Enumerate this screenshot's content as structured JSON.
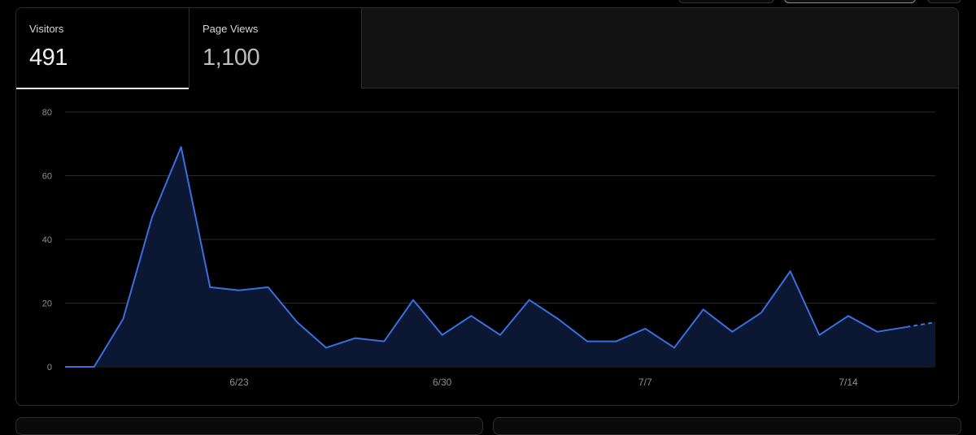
{
  "tabs": [
    {
      "label": "Visitors",
      "value": "491"
    },
    {
      "label": "Page Views",
      "value": "1,100"
    }
  ],
  "chart_data": {
    "type": "area",
    "title": "",
    "xlabel": "",
    "ylabel": "",
    "ylim": [
      0,
      80
    ],
    "yticks": [
      0,
      20,
      40,
      60,
      80
    ],
    "x": [
      "6/17",
      "6/18",
      "6/19",
      "6/20",
      "6/21",
      "6/22",
      "6/23",
      "6/24",
      "6/25",
      "6/26",
      "6/27",
      "6/28",
      "6/29",
      "6/30",
      "7/1",
      "7/2",
      "7/3",
      "7/4",
      "7/5",
      "7/6",
      "7/7",
      "7/8",
      "7/9",
      "7/10",
      "7/11",
      "7/12",
      "7/13",
      "7/14",
      "7/15",
      "7/16",
      "7/17"
    ],
    "xtick_labels": [
      "6/23",
      "6/30",
      "7/7",
      "7/14"
    ],
    "series": [
      {
        "values": [
          0,
          0,
          15,
          47,
          69,
          25,
          24,
          25,
          14,
          6,
          9,
          8,
          21,
          10,
          16,
          10,
          21,
          15,
          8,
          8,
          12,
          6,
          18,
          11,
          17,
          30,
          10,
          16,
          11,
          12.5,
          14
        ],
        "partial_from_index": 29
      }
    ],
    "grid": true,
    "colors": {
      "line": "#3b6fe0",
      "fill": "#0b1733",
      "grid": "#2a2a2a",
      "axis_text": "#8f8f8f"
    }
  }
}
